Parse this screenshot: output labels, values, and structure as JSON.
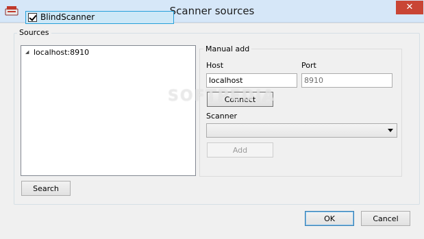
{
  "window": {
    "title": "Scanner sources",
    "close_glyph": "✕"
  },
  "sources": {
    "group_label": "Sources",
    "tree": {
      "root": "localhost:8910",
      "child": {
        "label": "BlindScanner",
        "checked": true
      }
    },
    "search_label": "Search"
  },
  "manual_add": {
    "group_label": "Manual add",
    "host_label": "Host",
    "host_value": "localhost",
    "port_label": "Port",
    "port_value": "8910",
    "connect_label": "Connect",
    "scanner_label": "Scanner",
    "scanner_value": "",
    "add_label": "Add"
  },
  "footer": {
    "ok_label": "OK",
    "cancel_label": "Cancel"
  },
  "watermark": "SOFTPEDIA",
  "colors": {
    "titlebar": "#d6e7f8",
    "close": "#c94535",
    "selection": "#cde8f7",
    "selection_border": "#26a0da"
  },
  "icons": {
    "app": "scanner-app-icon",
    "close": "close-icon",
    "expander": "triangle-down-icon",
    "dropdown": "chevron-down-icon"
  }
}
